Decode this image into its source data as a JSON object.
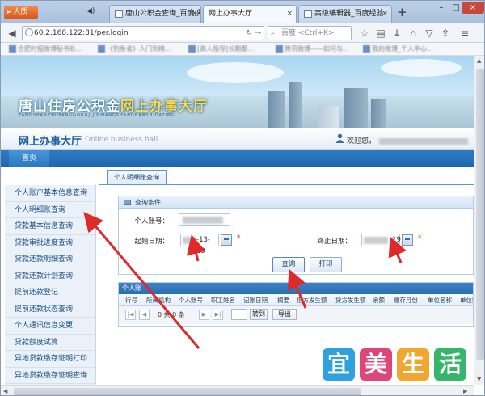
{
  "browser": {
    "firefox_label": "▸ 人质",
    "tabs": [
      {
        "label": "唐山公积金查询_百度搜索"
      },
      {
        "label": "网上办事大厅"
      },
      {
        "label": "高级编辑器_百度经验"
      }
    ],
    "url": "60.2.168.122:81/per.login",
    "search_placeholder": "百度 <Ctrl+K>",
    "bookmarks": [
      "合肥时报微博秘书处...",
      "《钓鱼者》人门到精...",
      "[高人指导]长期都... ",
      "腾讯微博——如何与...",
      "我的微博_个人中心..."
    ]
  },
  "site": {
    "banner_title_main": "唐山住房公积金",
    "banner_title_highlight": "网上办事大厅",
    "banner_subtitle": "TANGSHANZHUFANGGONGJIJINWANGSHANGBANSHIDATING",
    "hall_title": "网上办事大厅",
    "hall_subtitle": "Online business hall",
    "welcome": "欢迎您，",
    "menu_home": "首页"
  },
  "sidebar": {
    "items": [
      "个人账户基本信息查询",
      "个人明细账查询",
      "贷款基本信息查询",
      "贷款审批进度查询",
      "贷款还款明细查询",
      "贷款还款计划查询",
      "提前还款登记",
      "提前还款状态查询",
      "个人通讯信息变更",
      "贷款额度试算",
      "异地贷款缴存证明打印",
      "异地贷款缴存证明查询"
    ]
  },
  "main": {
    "tab_label": "个人明细账查询",
    "query_panel_title": "查询条件",
    "account_label": "个人账号：",
    "start_label": "起始日期：",
    "start_value": "-13-19",
    "end_label": "终止日期：",
    "end_value": "-19",
    "required_mark": "*",
    "query_button": "查询",
    "print_button": "打印",
    "grid_title": "个人账",
    "columns": [
      "行号",
      "所属机构",
      "个人账号",
      "职工姓名",
      "记账日期",
      "摘要",
      "借方发生额",
      "贷方发生额",
      "余额",
      "缴存月份",
      "单位名称",
      "单位账号"
    ],
    "pager_text": "0 共 0 条",
    "goto_button": "转到",
    "export_button": "导出"
  },
  "watermark": {
    "chars": [
      "宜",
      "美",
      "生",
      "活"
    ],
    "colors": [
      "#2fa0e0",
      "#e0457a",
      "#f1a72f",
      "#37b56a"
    ]
  },
  "colors": {
    "accent_blue": "#1d67ad",
    "annotation_red": "#e02a2a"
  }
}
